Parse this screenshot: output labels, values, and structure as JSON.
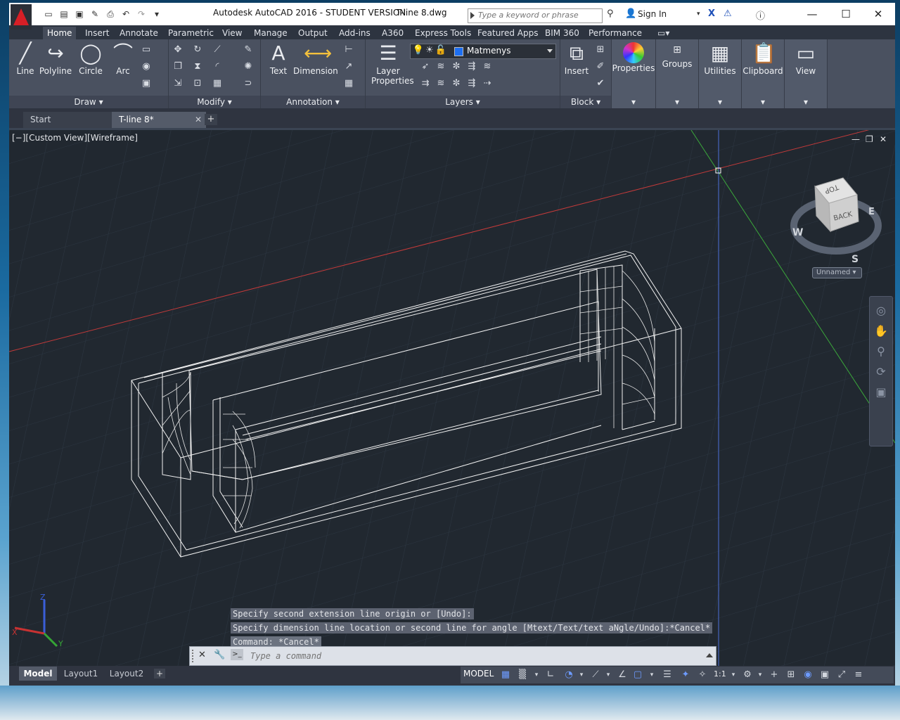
{
  "window": {
    "title": "Autodesk AutoCAD 2016 - STUDENT VERSION",
    "document": "T-line 8.dwg",
    "search_placeholder": "Type a keyword or phrase",
    "signin_label": "Sign In"
  },
  "ribbon": {
    "tabs": [
      "Home",
      "Insert",
      "Annotate",
      "Parametric",
      "View",
      "Manage",
      "Output",
      "Add-ins",
      "A360",
      "Express Tools",
      "Featured Apps",
      "BIM 360",
      "Performance"
    ],
    "active_tab": "Home",
    "draw": {
      "title": "Draw",
      "line": "Line",
      "polyline": "Polyline",
      "circle": "Circle",
      "arc": "Arc"
    },
    "modify": {
      "title": "Modify"
    },
    "annotation": {
      "title": "Annotation",
      "text": "Text",
      "dimension": "Dimension"
    },
    "layers": {
      "title": "Layers",
      "layer_properties_1": "Layer",
      "layer_properties_2": "Properties",
      "current_layer": "Matmenys",
      "layer_color": "#1d6ff2"
    },
    "block": {
      "title": "Block",
      "insert": "Insert"
    },
    "properties": {
      "label": "Properties"
    },
    "groups": {
      "label": "Groups"
    },
    "utilities": {
      "label": "Utilities"
    },
    "clipboard": {
      "label": "Clipboard"
    },
    "view": {
      "label": "View"
    }
  },
  "file_tabs": {
    "start": "Start",
    "current": "T-line 8*"
  },
  "viewport": {
    "label": "[−][Custom View][Wireframe]",
    "viewcube": {
      "top": "TOP",
      "back": "BACK",
      "w": "W",
      "e": "E",
      "s": "S",
      "ucs_name": "Unnamed"
    },
    "ucs": {
      "x": "X",
      "y": "Y",
      "z": "Z"
    }
  },
  "command": {
    "history": [
      "Specify second extension line origin or [Undo]:",
      "Specify dimension line location or second line for angle [Mtext/Text/text aNgle/Undo]:*Cancel*",
      "Command: *Cancel*"
    ],
    "placeholder": "Type a command"
  },
  "layout_tabs": [
    "Model",
    "Layout1",
    "Layout2"
  ],
  "status": {
    "model": "MODEL",
    "scale": "1:1"
  }
}
